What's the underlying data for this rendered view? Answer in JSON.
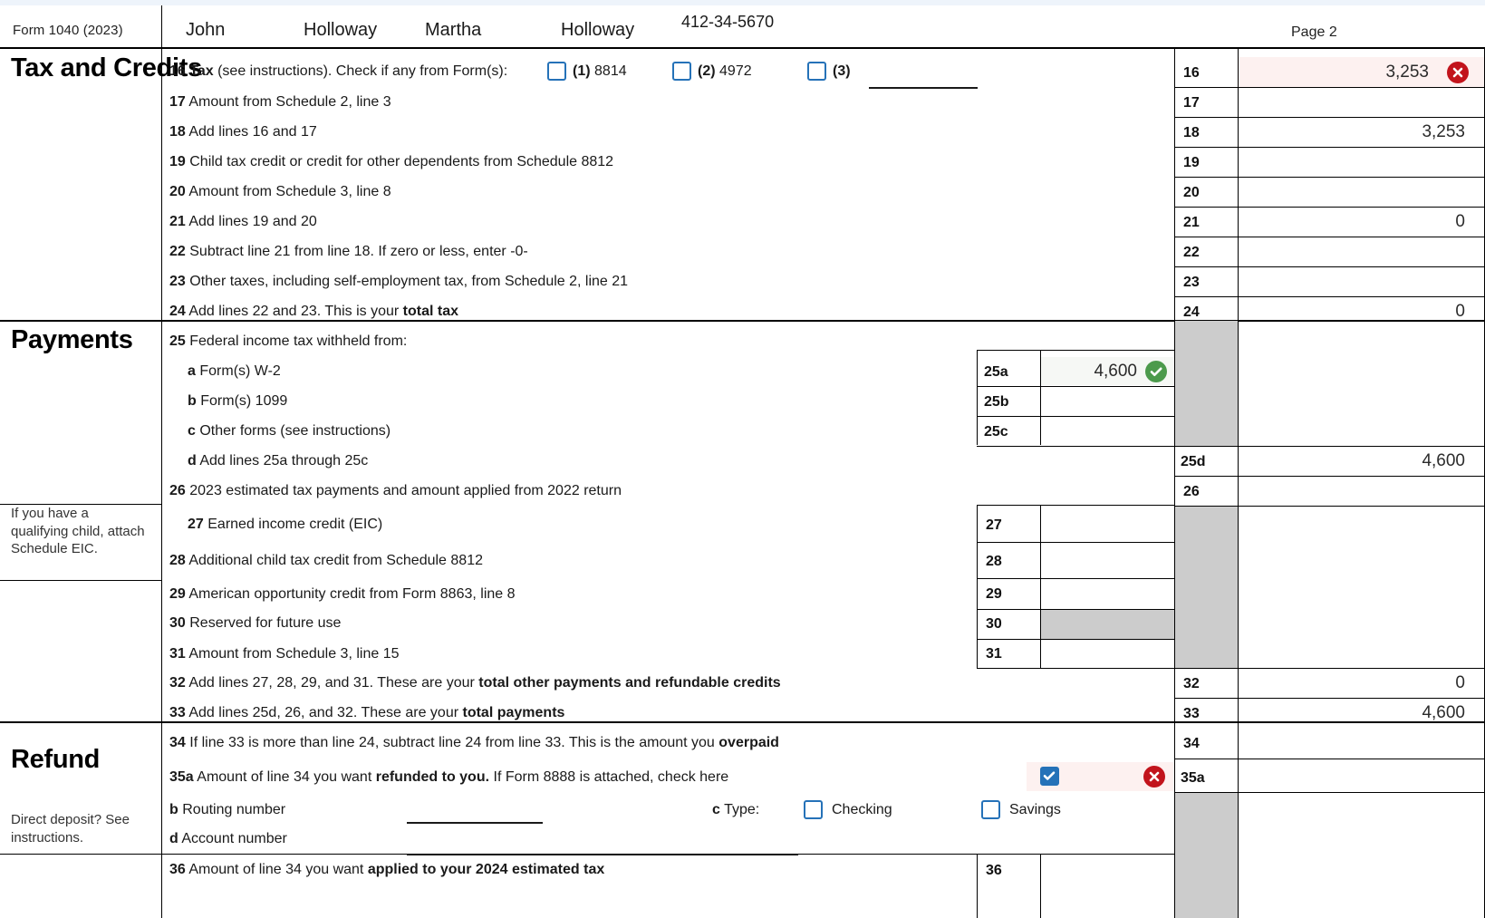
{
  "header": {
    "form_label": "Form 1040 (2023)",
    "first_name": "John",
    "last_name": "Holloway",
    "spouse_first_name": "Martha",
    "spouse_last_name": "Holloway",
    "ssn": "412-34-5670",
    "page_label": "Page 2"
  },
  "sections": {
    "tax_and_credits": "Tax and Credits",
    "payments": "Payments",
    "payments_note": "If you have a qualifying child, attach Schedule EIC.",
    "refund": "Refund",
    "refund_note": "Direct deposit? See instructions."
  },
  "line16": {
    "num": "16",
    "label_bold": "Tax",
    "label_rest": "(see instructions). Check if any from Form(s):",
    "opt1_label": "(1)",
    "opt1_form": "8814",
    "opt1_checked": false,
    "opt2_label": "(2)",
    "opt2_form": "4972",
    "opt2_checked": false,
    "opt3_label": "(3)",
    "opt3_checked": false,
    "opt3_value": "",
    "value": "3,253",
    "status": "error"
  },
  "lines": [
    {
      "num": "17",
      "text": "Amount from Schedule 2, line 3",
      "value": ""
    },
    {
      "num": "18",
      "text": "Add lines 16 and 17",
      "value": "3,253"
    },
    {
      "num": "19",
      "text": "Child tax credit or credit for other dependents from Schedule 8812",
      "value": ""
    },
    {
      "num": "20",
      "text": "Amount from Schedule 3, line 8",
      "value": ""
    },
    {
      "num": "21",
      "text": "Add lines 19 and 20",
      "value": "0"
    },
    {
      "num": "22",
      "text": "Subtract line 21 from line 18. If zero or less, enter -0-",
      "value": ""
    },
    {
      "num": "23",
      "text": "Other taxes, including self-employment tax, from Schedule 2, line 21",
      "value": ""
    },
    {
      "num": "24",
      "text_pre": "Add lines 22 and 23. This is your ",
      "text_bold": "total tax",
      "value": "0"
    }
  ],
  "payments_lines": {
    "l25": {
      "num": "25",
      "text": "Federal income tax withheld from:"
    },
    "l25a": {
      "num": "a",
      "text": "Form(s) W-2",
      "box": "25a",
      "value": "4,600",
      "status": "ok"
    },
    "l25b": {
      "num": "b",
      "text": "Form(s) 1099",
      "box": "25b",
      "value": ""
    },
    "l25c": {
      "num": "c",
      "text": "Other forms (see instructions)",
      "box": "25c",
      "value": ""
    },
    "l25d": {
      "num": "d",
      "text": "Add lines 25a through 25c",
      "box": "25d",
      "value": "4,600"
    },
    "l26": {
      "num": "26",
      "text": "2023 estimated tax payments and amount applied from 2022 return",
      "box": "26",
      "value": ""
    },
    "l27": {
      "num": "27",
      "text": "Earned income credit (EIC)",
      "box": "27",
      "value": ""
    },
    "l28": {
      "num": "28",
      "text": "Additional child tax credit from Schedule 8812",
      "box": "28",
      "value": ""
    },
    "l29": {
      "num": "29",
      "text": "American opportunity credit from Form 8863, line 8",
      "box": "29",
      "value": ""
    },
    "l30": {
      "num": "30",
      "text": "Reserved for future use",
      "box": "30",
      "value": ""
    },
    "l31": {
      "num": "31",
      "text": "Amount from Schedule 3, line 15",
      "box": "31",
      "value": ""
    },
    "l32": {
      "num": "32",
      "text_pre": "Add lines 27, 28, 29, and 31. These are your ",
      "text_bold": "total other payments and refundable credits",
      "box": "32",
      "value": "0"
    },
    "l33": {
      "num": "33",
      "text_pre": "Add lines 25d, 26, and 32. These are your ",
      "text_bold": "total payments",
      "box": "33",
      "value": "4,600"
    }
  },
  "refund_lines": {
    "l34": {
      "num": "34",
      "text_pre": "If line 33 is more than line 24, subtract line 24 from line 33. This is the amount you ",
      "text_bold": "overpaid",
      "box": "34",
      "value": ""
    },
    "l35a": {
      "num": "35a",
      "text_pre": "Amount of line 34 you want ",
      "text_bold": "refunded to you.",
      "text_post": " If Form 8888 is attached, check here",
      "box": "35a",
      "value": "",
      "checked": true,
      "status": "error"
    },
    "l35b": {
      "num": "b",
      "text": "Routing number",
      "value": ""
    },
    "l35c": {
      "num": "c",
      "text": "Type:",
      "checking_label": "Checking",
      "checking_checked": false,
      "savings_label": "Savings",
      "savings_checked": false
    },
    "l35d": {
      "num": "d",
      "text": "Account number",
      "value": ""
    },
    "l36": {
      "num": "36",
      "text_pre": "Amount of line 34 you want ",
      "text_bold": "applied to your 2024 estimated tax",
      "box": "36",
      "value": ""
    }
  },
  "colors": {
    "checkbox_blue": "#2572b8",
    "error_red": "#c2141c",
    "success_green": "#4c9a4c",
    "error_bg": "#fdf1f0",
    "success_bg": "#f6f8f5",
    "shaded_gray": "#cccccc"
  }
}
